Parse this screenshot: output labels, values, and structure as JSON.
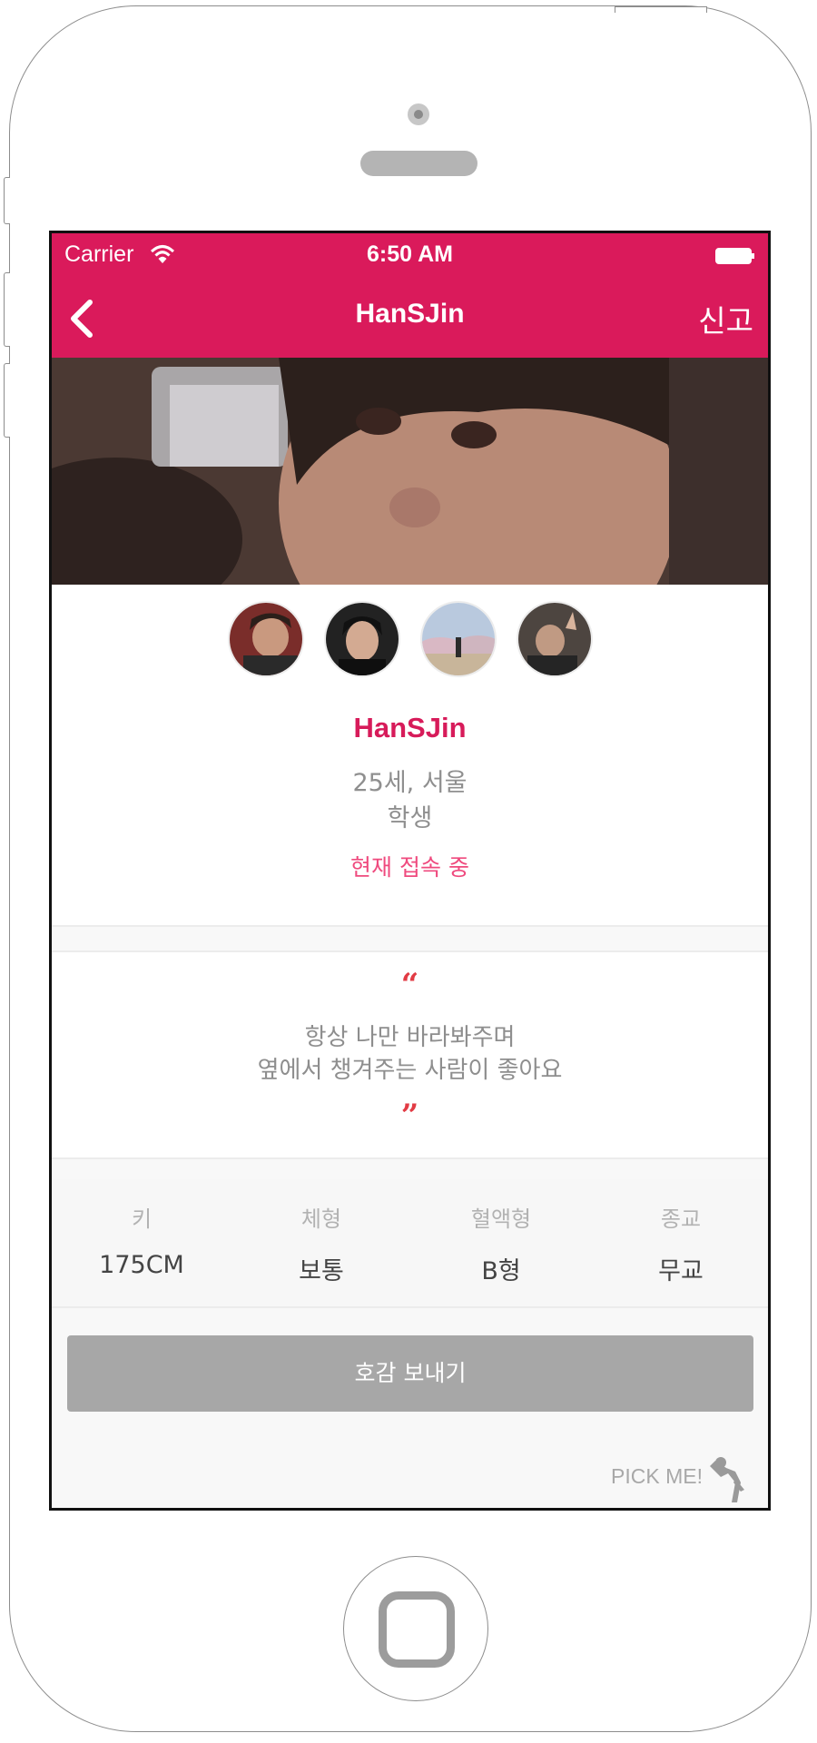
{
  "status_bar": {
    "carrier": "Carrier",
    "time": "6:50 AM"
  },
  "nav": {
    "title": "HanSJin",
    "report_label": "신고"
  },
  "profile": {
    "name": "HanSJin",
    "age_location": "25세, 서울",
    "occupation": "학생",
    "online_status": "현재 접속 중",
    "photo_count": 4
  },
  "quote": {
    "open_mark": "“",
    "line1": "항상 나만 바라봐주며",
    "line2": "옆에서 챙겨주는 사람이 좋아요",
    "close_mark": "”"
  },
  "stats": [
    {
      "label": "키",
      "value": "175CM"
    },
    {
      "label": "체형",
      "value": "보통"
    },
    {
      "label": "혈액형",
      "value": "B형"
    },
    {
      "label": "종교",
      "value": "무교"
    }
  ],
  "actions": {
    "send_like": "호감 보내기",
    "pick_me": "PICK ME!"
  },
  "colors": {
    "brand": "#da1a5b",
    "name": "#d71b5a",
    "online": "#ef4a7e",
    "quote_mark": "#e23b44",
    "button": "#a7a7a7"
  },
  "icons": [
    "wifi-icon",
    "battery-icon",
    "back-chevron-icon",
    "pick-me-person-icon"
  ]
}
